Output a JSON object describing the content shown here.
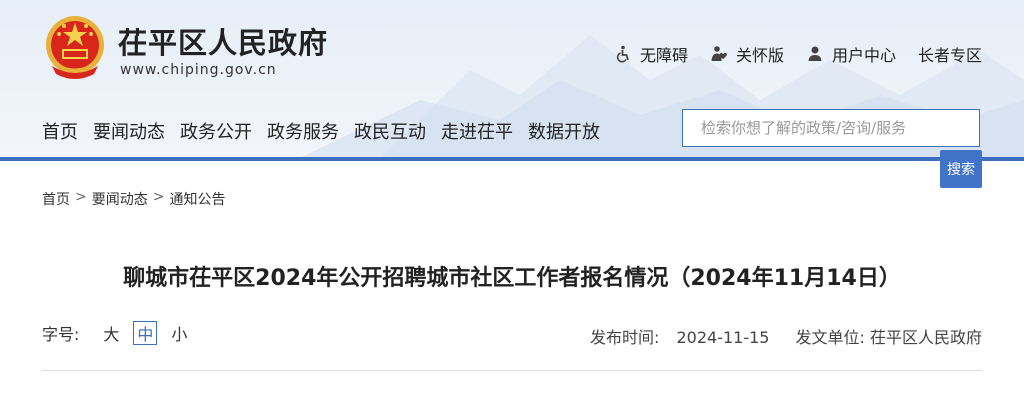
{
  "site": {
    "title": "茌平区人民政府",
    "url": "www.chiping.gov.cn"
  },
  "toplinks": [
    {
      "label": "无障碍",
      "icon": "wheelchair-icon"
    },
    {
      "label": "关怀版",
      "icon": "care-icon"
    },
    {
      "label": "用户中心",
      "icon": "user-icon"
    },
    {
      "label": "长者专区"
    }
  ],
  "nav": [
    "首页",
    "要闻动态",
    "政务公开",
    "政务服务",
    "政民互动",
    "走进茌平",
    "数据开放"
  ],
  "search": {
    "placeholder": "检索你想了解的政策/咨询/服务",
    "value": "",
    "button": "搜索"
  },
  "breadcrumb": [
    "首页",
    "要闻动态",
    "通知公告"
  ],
  "article": {
    "title": "聊城市茌平区2024年公开招聘城市社区工作者报名情况（2024年11月14日）",
    "font_size_label": "字号:",
    "font_sizes": [
      "大",
      "中",
      "小"
    ],
    "font_size_selected": "中",
    "publish_label": "发布时间:",
    "publish_date": "2024-11-15",
    "issuer_label": "发文单位:",
    "issuer": "茌平区人民政府"
  },
  "colors": {
    "accent": "#3d6fbf",
    "search_button": "#3f74c9",
    "header_bg": "#e9f0f8"
  }
}
